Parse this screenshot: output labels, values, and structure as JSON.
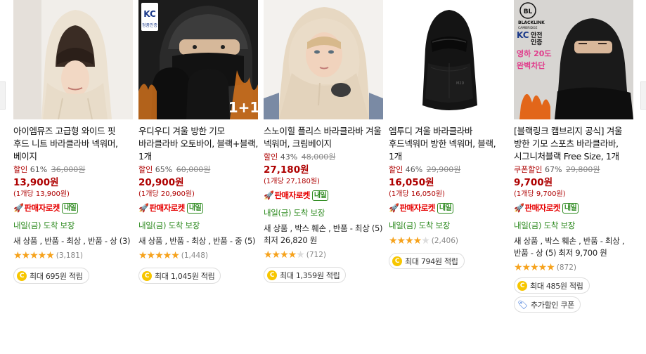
{
  "products": [
    {
      "title": "아이엠뮤즈 고급형 와이드 핏 후드 니트 바라클라바 넥워머, 베이지",
      "discount_label": "할인",
      "discount_percent": "61%",
      "original_price": "36,000원",
      "price": "13,900원",
      "unit_price": "(1개당 13,900원)",
      "rocket": "판매자로켓",
      "rocket_badge": "내일",
      "arrival": "내일(금) 도착 보장",
      "condition": "새 상품 , 반품 - 최상 , 반품 - 상 (3)",
      "rating": 5,
      "review_count": "(3,181)",
      "reward": "최대 695원 적립",
      "image": "beige-knit-hood-balaclava-photo"
    },
    {
      "title": "우디우디 겨울 방한 기모 바라클라바 오토바이, 블랙+블랙, 1개",
      "discount_label": "할인",
      "discount_percent": "65%",
      "original_price": "60,000원",
      "price": "20,900원",
      "unit_price": "(1개당 20,900원)",
      "rocket": "판매자로켓",
      "rocket_badge": "내일",
      "arrival": "내일(금) 도착 보장",
      "condition": "새 상품 , 반품 - 최상 , 반품 - 중 (5)",
      "rating": 5,
      "review_count": "(1,448)",
      "reward": "최대 1,045원 적립",
      "image": "black-motorcycle-balaclava-photo",
      "image_overlay": "1+1",
      "image_badge": "KC 정품인증"
    },
    {
      "title": "스노이힐 플리스 바라클라바 겨울 넥워머, 크림베이지",
      "discount_label": "할인",
      "discount_percent": "43%",
      "original_price": "48,000원",
      "price": "27,180원",
      "unit_price": "(1개당 27,180원)",
      "rocket": "판매자로켓",
      "rocket_badge": "내일",
      "arrival": "내일(금) 도착 보장",
      "condition": "새 상품 , 박스 훼손 , 반품 - 최상 (5) 최저 26,820 원",
      "rating": 4.5,
      "review_count": "(712)",
      "reward": "최대 1,359원 적립",
      "image": "cream-fleece-balaclava-photo"
    },
    {
      "title": "엠투디 겨울 바라클라바 후드넥워머 방한 넥워머, 블랙, 1개",
      "discount_label": "할인",
      "discount_percent": "46%",
      "original_price": "29,900원",
      "price": "16,050원",
      "unit_price": "(1개당 16,050원)",
      "rocket": "판매자로켓",
      "rocket_badge": "내일",
      "arrival": "내일(금) 도착 보장",
      "rating": 4.5,
      "review_count": "(2,406)",
      "reward": "최대 794원 적립",
      "image": "black-balaclava-mannequin-photo"
    },
    {
      "title": "[블랙링크 캠브리지 공식] 겨울 방한 기모 스포츠 바라클라바, 시그니처블랙 Free Size, 1개",
      "discount_label": "쿠폰할인",
      "discount_percent": "67%",
      "original_price": "29,800원",
      "price": "9,700원",
      "unit_price": "(1개당 9,700원)",
      "rocket": "판매자로켓",
      "rocket_badge": "내일",
      "arrival": "내일(금) 도착 보장",
      "condition": "새 상품 , 박스 훼손 , 반품 - 최상 , 반품 - 상 (5) 최저 9,700 원",
      "rating": 5,
      "review_count": "(872)",
      "reward": "최대 485원 적립",
      "extra_coupon": "추가할인 쿠폰",
      "image": "blacklink-sport-balaclava-photo",
      "image_brand": "BLACKLINK",
      "image_brand_sub": "CAMBRIDGE",
      "image_badge1": "KC 안전인증",
      "image_badge2": "영하 20도",
      "image_badge3": "완벽차단"
    }
  ],
  "colors": {
    "price_red": "#ae0000",
    "rocket_red": "#e60000",
    "arrival_green": "#2d8a1f",
    "star_orange": "#f6a21c",
    "coin_yellow": "#f7c600",
    "coupon_blue": "#2063d6"
  }
}
